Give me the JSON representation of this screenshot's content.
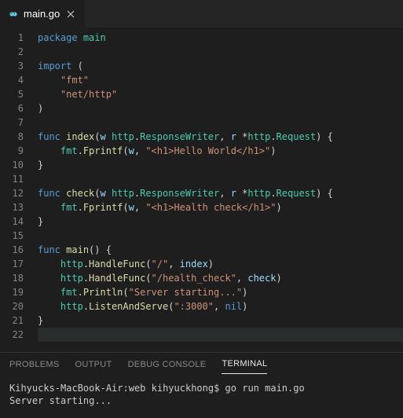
{
  "tab": {
    "filename": "main.go",
    "icon": "go-file-icon"
  },
  "code": {
    "lines": [
      {
        "n": 1,
        "t": [
          [
            "kw",
            "package"
          ],
          [
            "op",
            " "
          ],
          [
            "pkg",
            "main"
          ]
        ]
      },
      {
        "n": 2,
        "t": []
      },
      {
        "n": 3,
        "t": [
          [
            "kw",
            "import"
          ],
          [
            "op",
            " ("
          ]
        ]
      },
      {
        "n": 4,
        "t": [
          [
            "op",
            "    "
          ],
          [
            "str",
            "\"fmt\""
          ]
        ]
      },
      {
        "n": 5,
        "t": [
          [
            "op",
            "    "
          ],
          [
            "str",
            "\"net/http\""
          ]
        ]
      },
      {
        "n": 6,
        "t": [
          [
            "op",
            ")"
          ]
        ]
      },
      {
        "n": 7,
        "t": []
      },
      {
        "n": 8,
        "t": [
          [
            "kw",
            "func"
          ],
          [
            "op",
            " "
          ],
          [
            "fn",
            "index"
          ],
          [
            "op",
            "("
          ],
          [
            "var",
            "w"
          ],
          [
            "op",
            " "
          ],
          [
            "typ",
            "http"
          ],
          [
            "op",
            "."
          ],
          [
            "typ",
            "ResponseWriter"
          ],
          [
            "op",
            ", "
          ],
          [
            "var",
            "r"
          ],
          [
            "op",
            " *"
          ],
          [
            "typ",
            "http"
          ],
          [
            "op",
            "."
          ],
          [
            "typ",
            "Request"
          ],
          [
            "op",
            ") {"
          ]
        ]
      },
      {
        "n": 9,
        "t": [
          [
            "op",
            "    "
          ],
          [
            "typ",
            "fmt"
          ],
          [
            "op",
            "."
          ],
          [
            "fn",
            "Fprintf"
          ],
          [
            "op",
            "("
          ],
          [
            "var",
            "w"
          ],
          [
            "op",
            ", "
          ],
          [
            "str",
            "\"<h1>Hello World</h1>\""
          ],
          [
            "op",
            ")"
          ]
        ]
      },
      {
        "n": 10,
        "t": [
          [
            "op",
            "}"
          ]
        ]
      },
      {
        "n": 11,
        "t": []
      },
      {
        "n": 12,
        "t": [
          [
            "kw",
            "func"
          ],
          [
            "op",
            " "
          ],
          [
            "fn",
            "check"
          ],
          [
            "op",
            "("
          ],
          [
            "var",
            "w"
          ],
          [
            "op",
            " "
          ],
          [
            "typ",
            "http"
          ],
          [
            "op",
            "."
          ],
          [
            "typ",
            "ResponseWriter"
          ],
          [
            "op",
            ", "
          ],
          [
            "var",
            "r"
          ],
          [
            "op",
            " *"
          ],
          [
            "typ",
            "http"
          ],
          [
            "op",
            "."
          ],
          [
            "typ",
            "Request"
          ],
          [
            "op",
            ") {"
          ]
        ]
      },
      {
        "n": 13,
        "t": [
          [
            "op",
            "    "
          ],
          [
            "typ",
            "fmt"
          ],
          [
            "op",
            "."
          ],
          [
            "fn",
            "Fprintf"
          ],
          [
            "op",
            "("
          ],
          [
            "var",
            "w"
          ],
          [
            "op",
            ", "
          ],
          [
            "str",
            "\"<h1>Health check</h1>\""
          ],
          [
            "op",
            ")"
          ]
        ]
      },
      {
        "n": 14,
        "t": [
          [
            "op",
            "}"
          ]
        ]
      },
      {
        "n": 15,
        "t": []
      },
      {
        "n": 16,
        "t": [
          [
            "kw",
            "func"
          ],
          [
            "op",
            " "
          ],
          [
            "fn",
            "main"
          ],
          [
            "op",
            "() {"
          ]
        ]
      },
      {
        "n": 17,
        "t": [
          [
            "op",
            "    "
          ],
          [
            "typ",
            "http"
          ],
          [
            "op",
            "."
          ],
          [
            "fn",
            "HandleFunc"
          ],
          [
            "op",
            "("
          ],
          [
            "str",
            "\"/\""
          ],
          [
            "op",
            ", "
          ],
          [
            "var",
            "index"
          ],
          [
            "op",
            ")"
          ]
        ]
      },
      {
        "n": 18,
        "t": [
          [
            "op",
            "    "
          ],
          [
            "typ",
            "http"
          ],
          [
            "op",
            "."
          ],
          [
            "fn",
            "HandleFunc"
          ],
          [
            "op",
            "("
          ],
          [
            "str",
            "\"/health_check\""
          ],
          [
            "op",
            ", "
          ],
          [
            "var",
            "check"
          ],
          [
            "op",
            ")"
          ]
        ]
      },
      {
        "n": 19,
        "t": [
          [
            "op",
            "    "
          ],
          [
            "typ",
            "fmt"
          ],
          [
            "op",
            "."
          ],
          [
            "fn",
            "Println"
          ],
          [
            "op",
            "("
          ],
          [
            "str",
            "\"Server starting...\""
          ],
          [
            "op",
            ")"
          ]
        ]
      },
      {
        "n": 20,
        "t": [
          [
            "op",
            "    "
          ],
          [
            "typ",
            "http"
          ],
          [
            "op",
            "."
          ],
          [
            "fn",
            "ListenAndServe"
          ],
          [
            "op",
            "("
          ],
          [
            "str",
            "\":3000\""
          ],
          [
            "op",
            ", "
          ],
          [
            "const",
            "nil"
          ],
          [
            "op",
            ")"
          ]
        ]
      },
      {
        "n": 21,
        "t": [
          [
            "op",
            "}"
          ]
        ]
      },
      {
        "n": 22,
        "t": [],
        "current": true
      }
    ]
  },
  "panel": {
    "tabs": {
      "problems": "PROBLEMS",
      "output": "OUTPUT",
      "debug": "DEBUG CONSOLE",
      "terminal": "TERMINAL"
    },
    "active": "terminal"
  },
  "terminal": {
    "prompt": "Kihyucks-MacBook-Air:web kihyuckhong$ ",
    "command": "go run main.go",
    "output": "Server starting..."
  }
}
